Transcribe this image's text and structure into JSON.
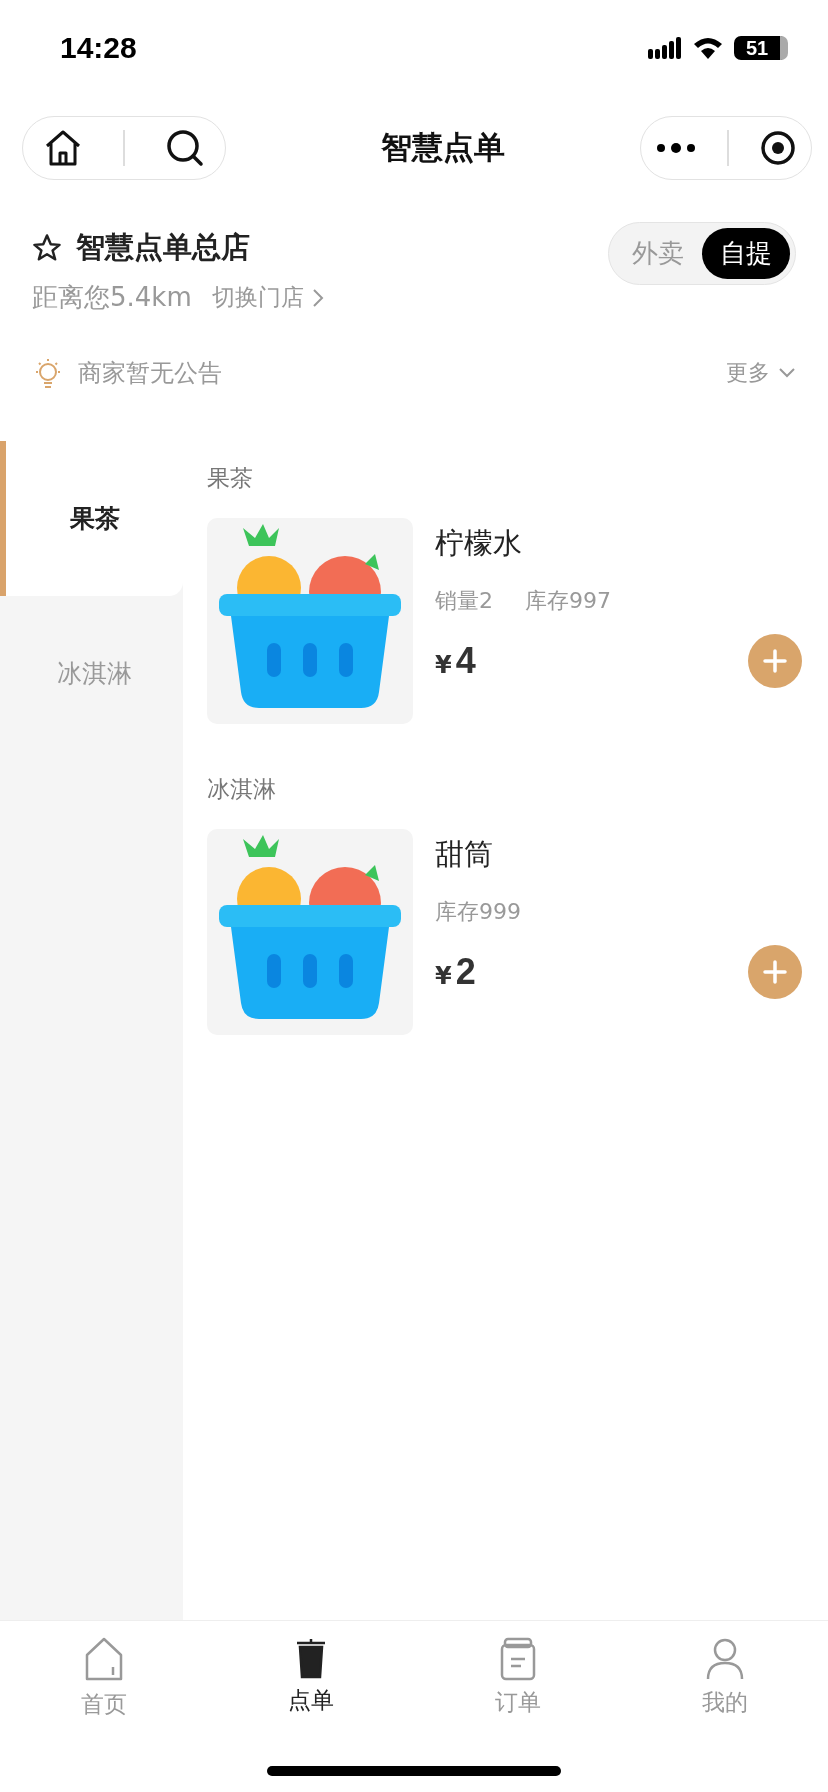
{
  "status_bar": {
    "time": "14:28",
    "battery": "51"
  },
  "nav": {
    "title": "智慧点单"
  },
  "store": {
    "name": "智慧点单总店",
    "distance": "距离您5.4km",
    "switch_label": "切换门店",
    "modes": [
      {
        "label": "外卖",
        "selected": false
      },
      {
        "label": "自提",
        "selected": true
      }
    ]
  },
  "notice": {
    "text": "商家暂无公告",
    "more": "更多"
  },
  "categories": [
    {
      "label": "果茶",
      "selected": true
    },
    {
      "label": "冰淇淋",
      "selected": false
    }
  ],
  "sections": [
    {
      "title": "果茶",
      "products": [
        {
          "name": "柠檬水",
          "stats": [
            "销量2",
            "库存997"
          ],
          "currency": "¥",
          "price": "4"
        }
      ]
    },
    {
      "title": "冰淇淋",
      "products": [
        {
          "name": "甜筒",
          "stats": [
            "库存999"
          ],
          "currency": "¥",
          "price": "2"
        }
      ]
    }
  ],
  "tab_bar": [
    {
      "label": "首页",
      "kind": "home",
      "selected": false
    },
    {
      "label": "点单",
      "kind": "cup",
      "selected": true
    },
    {
      "label": "订单",
      "kind": "order",
      "selected": false
    },
    {
      "label": "我的",
      "kind": "user",
      "selected": false
    }
  ]
}
